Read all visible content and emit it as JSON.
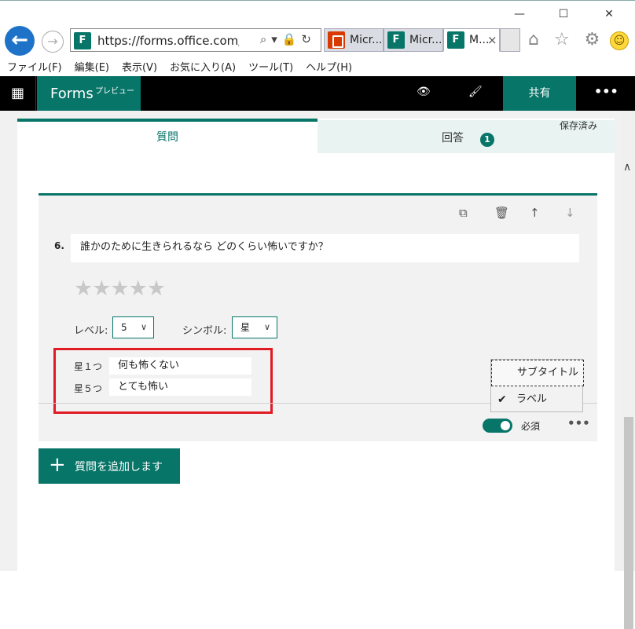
{
  "window": {
    "minimize": "—",
    "maximize": "☐",
    "close": "✕"
  },
  "browser": {
    "back_glyph": "←",
    "forward_glyph": "→",
    "url": "https://forms.office.com/Pa",
    "tabs": [
      {
        "title": "Micr...",
        "icon": "office-icon"
      },
      {
        "title": "Micr...",
        "icon": "forms-icon"
      },
      {
        "title": "M...",
        "icon": "forms-icon",
        "close": "×"
      }
    ],
    "right_icons": "⌂ ☆ ⚙"
  },
  "menubar": [
    "ファイル(F)",
    "編集(E)",
    "表示(V)",
    "お気に入り(A)",
    "ツール(T)",
    "ヘルプ(H)"
  ],
  "app": {
    "name": "Forms",
    "preview": "プレビュー",
    "share_label": "共有",
    "more": "•••",
    "waffle": "▦"
  },
  "tabs": {
    "questions": "質問",
    "responses": "回答",
    "responses_badge": "1",
    "saved": "保存済み"
  },
  "question": {
    "number": "6.",
    "text": "誰かのために生きられるなら どのくらい怖いですか？",
    "stars": "★★★★★",
    "level_label": "レベル:",
    "level_value": "5",
    "symbol_label": "シンボル:",
    "symbol_value": "星",
    "levels": [
      {
        "name": "星１つ",
        "text": "何も怖くない"
      },
      {
        "name": "星５つ",
        "text": "とても怖い"
      }
    ],
    "required_label": "必須",
    "required_on": true
  },
  "context_menu": {
    "items": [
      {
        "label": "サブタイトル",
        "checked": false
      },
      {
        "label": "ラベル",
        "checked": true
      }
    ],
    "check_glyph": "✔"
  },
  "add_question_label": "質問を追加します",
  "colors": {
    "accent": "#077568",
    "highlight_border": "#e01b24",
    "back_button": "#1e73c8"
  }
}
